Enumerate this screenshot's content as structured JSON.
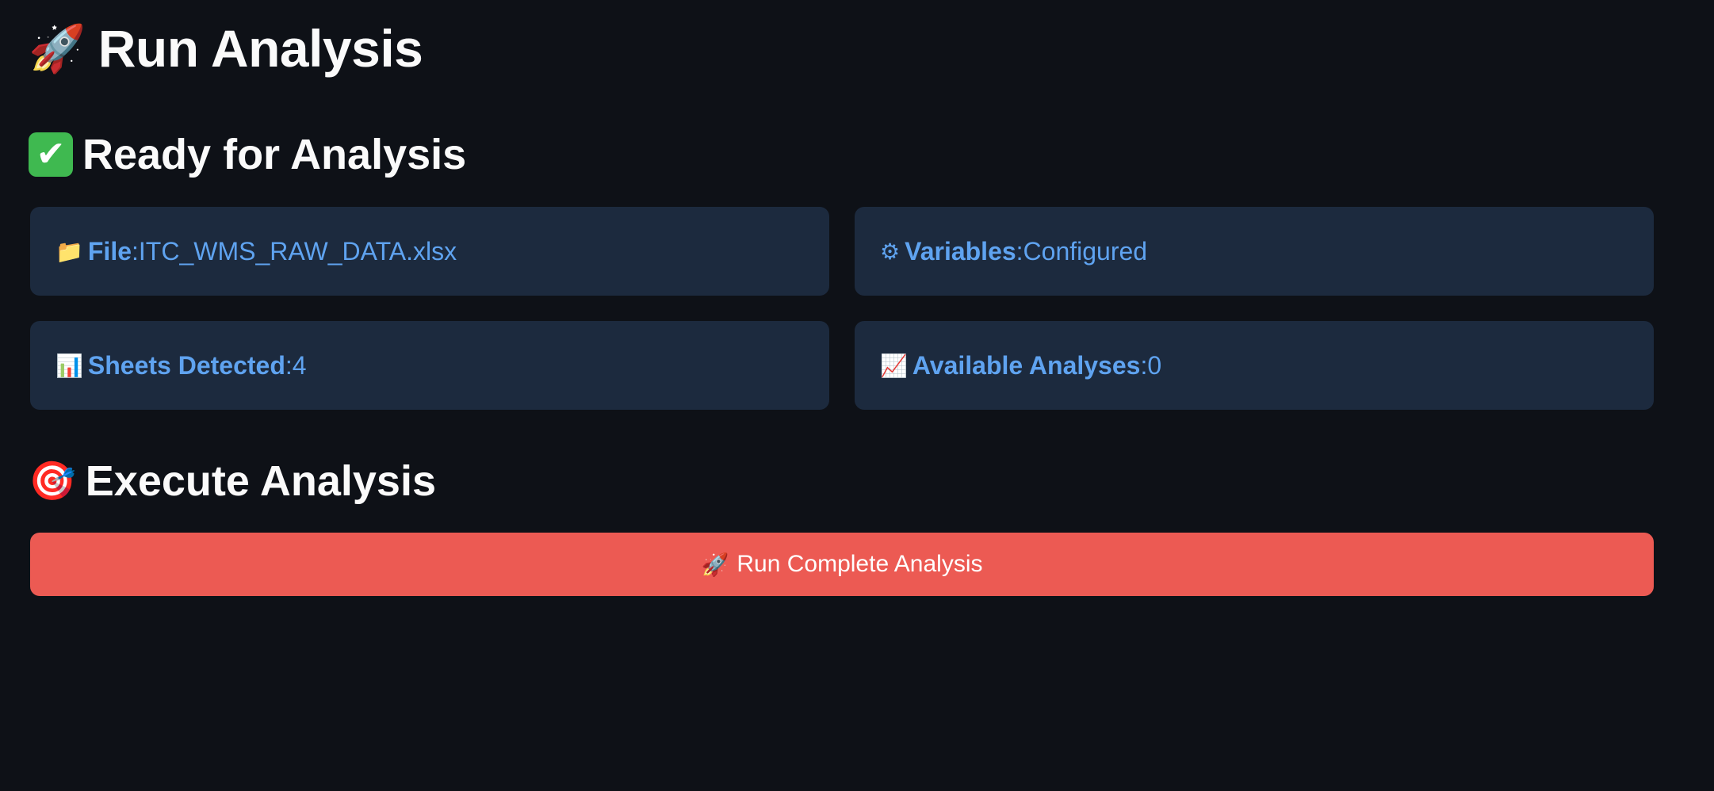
{
  "page": {
    "title": "Run Analysis",
    "title_icon": "🚀"
  },
  "ready_section": {
    "title": "Ready for Analysis",
    "icon": "✔",
    "cards": {
      "file": {
        "icon": "📁",
        "label": "File",
        "value": "ITC_WMS_RAW_DATA.xlsx"
      },
      "variables": {
        "icon": "⚙",
        "label": "Variables",
        "value": "Configured"
      },
      "sheets": {
        "icon": "📊",
        "label": "Sheets Detected",
        "value": "4"
      },
      "analyses": {
        "icon": "📈",
        "label": "Available Analyses",
        "value": "0"
      }
    }
  },
  "execute_section": {
    "title": "Execute Analysis",
    "icon": "🎯",
    "button": {
      "icon": "🚀",
      "label": "Run Complete Analysis"
    }
  },
  "colors": {
    "background": "#0e1117",
    "card_background": "#1c2a3e",
    "card_text": "#5fa3f0",
    "button_background": "#ec5a53",
    "check_green": "#3fb950"
  }
}
